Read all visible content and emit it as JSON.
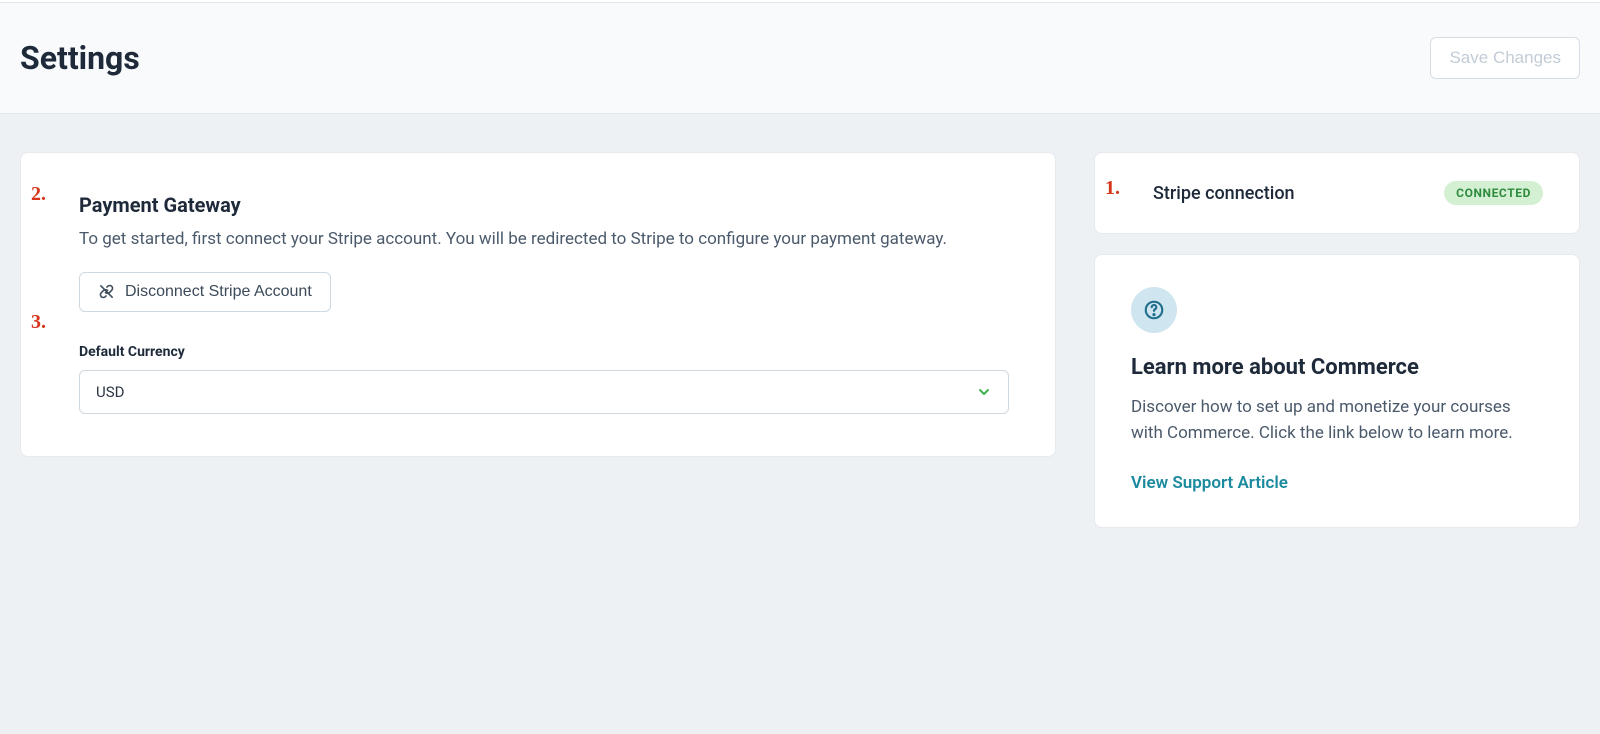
{
  "header": {
    "title": "Settings",
    "save_label": "Save Changes"
  },
  "annotations": {
    "n1": "1.",
    "n2": "2.",
    "n3": "3."
  },
  "gateway": {
    "heading": "Payment Gateway",
    "description": "To get started, first connect your Stripe account. You will be redirected to Stripe to configure your payment gateway.",
    "disconnect_label": "Disconnect Stripe Account",
    "currency_label": "Default Currency",
    "currency_value": "USD"
  },
  "stripe": {
    "label": "Stripe connection",
    "status": "CONNECTED"
  },
  "help": {
    "title": "Learn more about Commerce",
    "body": "Discover how to set up and monetize your courses with Commerce. Click the link below to learn more.",
    "link_label": "View Support Article"
  }
}
